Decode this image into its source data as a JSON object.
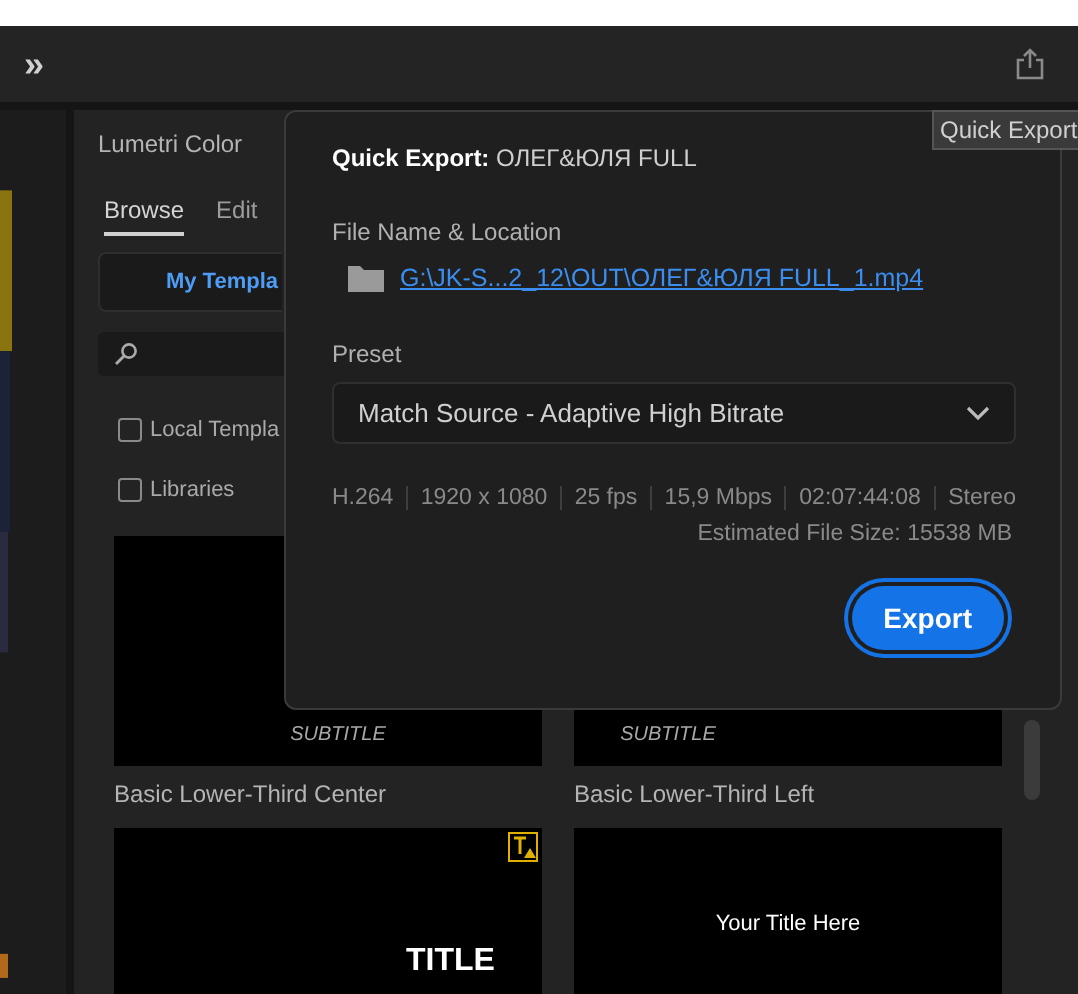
{
  "toolbar": {
    "overflow_glyph": "»"
  },
  "tooltip": "Quick Export",
  "panel": {
    "title": "Lumetri Color",
    "tabs": [
      {
        "label": "Browse",
        "selected": true
      },
      {
        "label": "Edit",
        "selected": false
      }
    ],
    "template_button": "My Templa",
    "checkboxes": [
      {
        "label": "Local Templa",
        "checked": false
      },
      {
        "label": "Libraries",
        "checked": false
      }
    ],
    "templates": [
      {
        "kind": "lower-third",
        "subtitle": "SUBTITLE",
        "name": "Basic Lower-Third Center"
      },
      {
        "kind": "lower-third",
        "subtitle": "SUBTITLE",
        "name": "Basic Lower-Third Left"
      },
      {
        "kind": "title",
        "text": "TITLE",
        "missing_font": true
      },
      {
        "kind": "title",
        "text": "Your Title Here",
        "missing_font": false
      }
    ]
  },
  "popup": {
    "title": "**Quick Export:** ОЛЕГ&ЮЛЯ FULL",
    "location_label": "File Name & Location",
    "path": "G:\\JK-S...2_12\\OUT\\ОЛЕГ&ЮЛЯ FULL_1.mp4",
    "preset_label": "Preset",
    "preset": "Match Source - Adaptive High Bitrate",
    "specs": [
      "H.264",
      "1920 x 1080",
      "25 fps",
      "15,9 Mbps",
      "02:07:44:08",
      "Stereo"
    ],
    "file_size": "Estimated File Size: 15538 MB",
    "export_button": "Export"
  }
}
